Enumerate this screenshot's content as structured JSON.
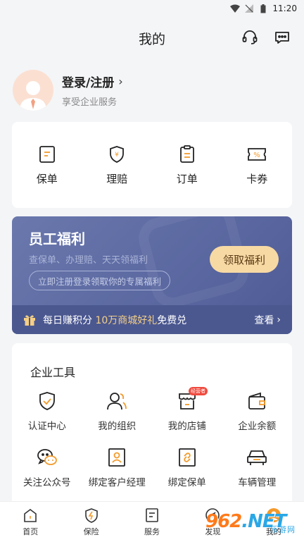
{
  "status_bar": {
    "time": "11:20"
  },
  "header": {
    "title": "我的"
  },
  "profile": {
    "login_label": "登录/注册",
    "subtitle": "享受企业服务"
  },
  "quick_actions": [
    {
      "label": "保单",
      "icon": "policy-icon"
    },
    {
      "label": "理赔",
      "icon": "claim-shield-icon"
    },
    {
      "label": "订单",
      "icon": "order-icon"
    },
    {
      "label": "卡券",
      "icon": "coupon-icon"
    }
  ],
  "welfare": {
    "title": "员工福利",
    "subtitle": "查保单、办理赔、天天领福利",
    "pill": "立即注册登录领取你的专属福利",
    "button": "领取福利",
    "promo_prefix": "每日赚积分 ",
    "promo_highlight": "10万商城好礼",
    "promo_suffix": "免费兑",
    "view": "查看"
  },
  "tools": {
    "title": "企业工具",
    "items": [
      {
        "label": "认证中心",
        "icon": "certify-shield-icon"
      },
      {
        "label": "我的组织",
        "icon": "organization-icon"
      },
      {
        "label": "我的店铺",
        "icon": "shop-icon",
        "badge": "经营者"
      },
      {
        "label": "企业余额",
        "icon": "wallet-icon"
      },
      {
        "label": "关注公众号",
        "icon": "wechat-icon"
      },
      {
        "label": "绑定客户经理",
        "icon": "manager-icon"
      },
      {
        "label": "绑定保单",
        "icon": "link-policy-icon"
      },
      {
        "label": "车辆管理",
        "icon": "car-icon"
      }
    ]
  },
  "tabbar": [
    {
      "label": "首页",
      "icon": "home-icon"
    },
    {
      "label": "保险",
      "icon": "insurance-icon"
    },
    {
      "label": "服务",
      "icon": "service-icon"
    },
    {
      "label": "发现",
      "icon": "discover-icon"
    },
    {
      "label": "我的",
      "icon": "profile-icon"
    }
  ],
  "watermark": {
    "logo_main": "962",
    "logo_net": ".NET",
    "sub": "乐游网"
  },
  "colors": {
    "accent": "#f39a2b",
    "welfare_bg": "#5a67a0",
    "welfare_btn": "#f7d9a4",
    "badge": "#f04b3f"
  }
}
